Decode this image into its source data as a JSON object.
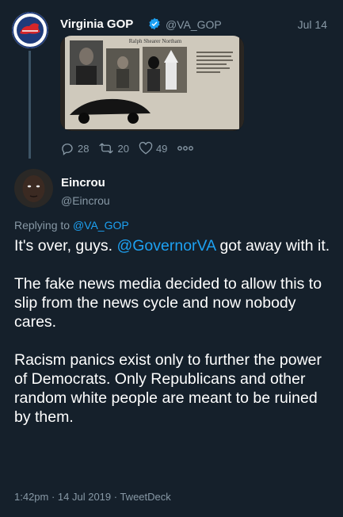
{
  "parent_tweet": {
    "name": "Virginia GOP",
    "handle": "@VA_GOP",
    "date": "Jul 14",
    "media_caption": "Ralph Shearer Northam",
    "avatar_label": "VIRGINIA",
    "actions": {
      "replies": "28",
      "retweets": "20",
      "likes": "49"
    }
  },
  "reply_tweet": {
    "name": "Eincrou",
    "handle": "@Eincrou",
    "replying_prefix": "Replying to",
    "replying_handle": "@VA_GOP",
    "p1_before": "It's over, guys.",
    "p1_mention": "@GovernorVA",
    "p1_after": "got away with it.",
    "p2": "The fake news media decided to allow this to slip from the news cycle and now nobody cares.",
    "p3": "Racism panics exist only to further the power of Democrats. Only Republicans and other random white people are meant to be ruined by them.",
    "timestamp": "1:42pm · 14 Jul 2019 · TweetDeck"
  },
  "colors": {
    "background": "#15202b",
    "accent": "#1da1f2",
    "muted": "#8899a6"
  },
  "icons": [
    "verified-icon",
    "reply-icon",
    "retweet-icon",
    "like-icon",
    "more-icon"
  ]
}
